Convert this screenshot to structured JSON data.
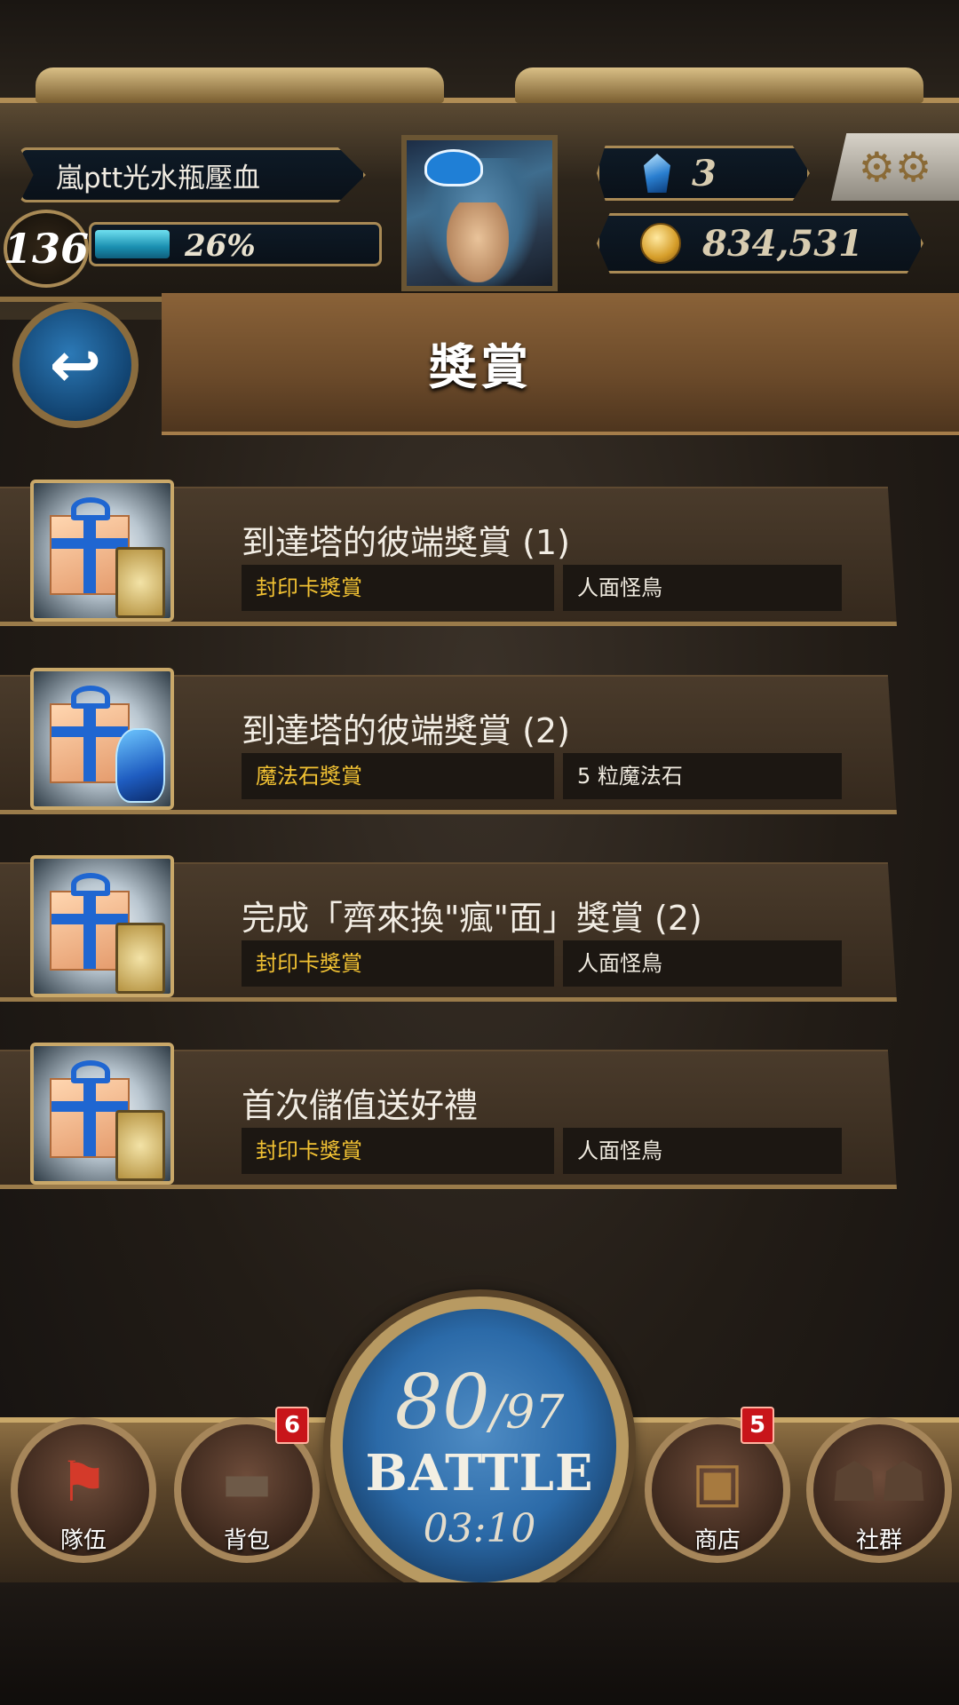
{
  "header": {
    "player_name": "嵐ptt光水瓶壓血",
    "level": "136",
    "exp_percent_text": "26%",
    "exp_fraction": 0.26,
    "gems": "3",
    "coins": "834,531",
    "settings_icon": "gear-icon"
  },
  "page": {
    "title": "獎賞",
    "back_icon": "back-arrow-icon"
  },
  "rewards": [
    {
      "title": "到達塔的彼端獎賞 (1)",
      "type": "封印卡獎賞",
      "item": "人面怪鳥",
      "icon": "gift-card"
    },
    {
      "title": "到達塔的彼端獎賞 (2)",
      "type": "魔法石獎賞",
      "item": "5 粒魔法石",
      "icon": "gift-stone"
    },
    {
      "title": "完成「齊來換\"瘋\"面」獎賞 (2)",
      "type": "封印卡獎賞",
      "item": "人面怪鳥",
      "icon": "gift-card"
    },
    {
      "title": "首次儲值送好禮",
      "type": "封印卡獎賞",
      "item": "人面怪鳥",
      "icon": "gift-card"
    }
  ],
  "nav": {
    "team": {
      "label": "隊伍",
      "icon": "flag-icon"
    },
    "bag": {
      "label": "背包",
      "icon": "bag-icon",
      "badge": "6"
    },
    "battle": {
      "stamina_current": "80",
      "stamina_max": "/97",
      "label": "BATTLE",
      "timer": "03:10"
    },
    "shop": {
      "label": "商店",
      "icon": "chest-icon",
      "badge": "5"
    },
    "social": {
      "label": "社群",
      "icon": "people-icon"
    }
  },
  "colors": {
    "reward_type": "#f2c233",
    "exp_fill": "#1a8fb0",
    "badge": "#c8151a"
  }
}
